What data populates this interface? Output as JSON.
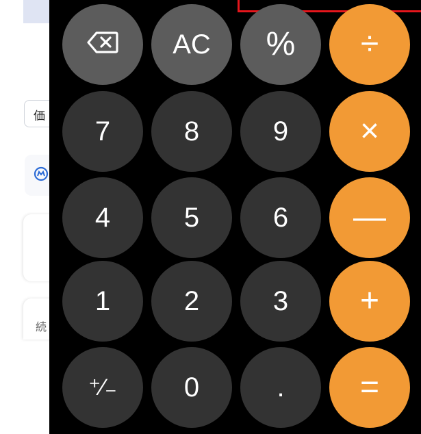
{
  "background_app": {
    "chip_label": "価",
    "row_icon": "m-circle-icon",
    "card_text": "続"
  },
  "keys": {
    "backspace": "⌫",
    "all_clear": "AC",
    "percent": "%",
    "divide": "÷",
    "seven": "7",
    "eight": "8",
    "nine": "9",
    "multiply": "×",
    "four": "4",
    "five": "5",
    "six": "6",
    "minus": "—",
    "one": "1",
    "two": "2",
    "three": "3",
    "plus": "+",
    "plus_minus": "⁺∕₋",
    "zero": "0",
    "decimal": ".",
    "equals": "="
  },
  "colors": {
    "digit_key": "#333333",
    "function_key": "#5c5c5c",
    "operator_key": "#f29a35",
    "highlight": "#e5161c",
    "panel": "#000000"
  }
}
